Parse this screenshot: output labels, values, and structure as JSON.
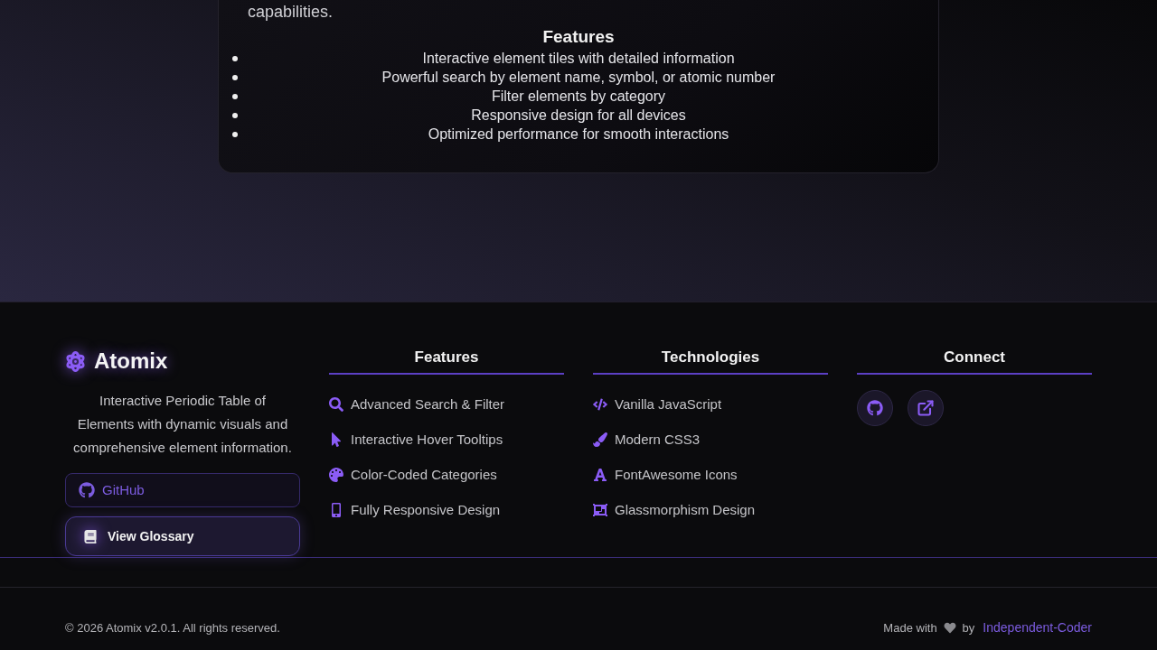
{
  "intro_card": {
    "text_fragment": "capabilities.",
    "features_heading": "Features",
    "features": [
      "Interactive element tiles with detailed information",
      "Powerful search by element name, symbol, or atomic number",
      "Filter elements by category",
      "Responsive design for all devices",
      "Optimized performance for smooth interactions"
    ]
  },
  "footer": {
    "brand": {
      "name": "Atomix",
      "description": "Interactive Periodic Table of Elements with dynamic visuals and comprehensive element information."
    },
    "buttons": [
      {
        "label": "GitHub",
        "kind": "outline"
      },
      {
        "label": "View Glossary",
        "kind": "primary"
      }
    ],
    "columns": [
      {
        "heading": "Features",
        "items": [
          "Advanced Search & Filter",
          "Interactive Hover Tooltips",
          "Color-Coded Categories",
          "Fully Responsive Design"
        ]
      },
      {
        "heading": "Technologies",
        "items": [
          "Vanilla JavaScript",
          "Modern CSS3",
          "FontAwesome Icons",
          "Glassmorphism Design"
        ]
      }
    ],
    "connect": {
      "heading": "Connect",
      "links": [
        {
          "kind": "github"
        },
        {
          "kind": "external"
        }
      ]
    }
  },
  "bottom_bar": {
    "copyright": "© 2026 Atomix v2.0.1. All rights reserved.",
    "made_with": "Made with",
    "by": "by",
    "author": "Independent-Coder"
  }
}
